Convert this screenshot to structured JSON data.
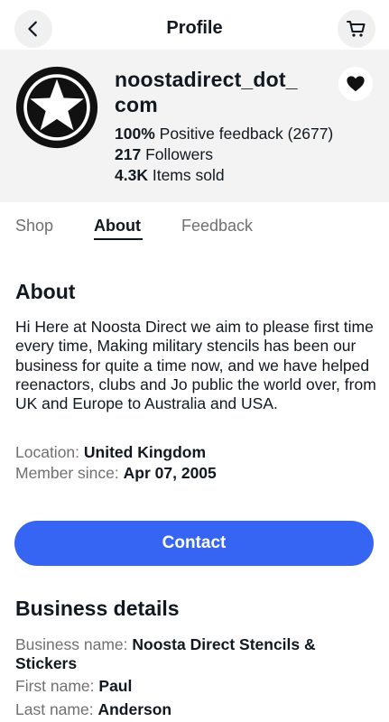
{
  "header": {
    "title": "Profile"
  },
  "icons": {
    "back": "chevron-left-icon",
    "cart": "cart-icon",
    "favorite": "heart-icon",
    "avatar": "star-logo"
  },
  "profile": {
    "name": "noostadirect_dot_ com",
    "feedback_pct": "100%",
    "feedback_text": "Positive feedback (2677)",
    "followers_count": "217",
    "followers_text": "Followers",
    "items_sold_count": "4.3K",
    "items_sold_text": "Items sold"
  },
  "tabs": [
    {
      "label": "Shop",
      "active": false
    },
    {
      "label": "About",
      "active": true
    },
    {
      "label": "Feedback",
      "active": false
    }
  ],
  "about": {
    "heading": "About",
    "bio": "Hi Here at Noosta Direct we aim to please first time every time, Making military stencils has been our business for quite a time now, and we have helped reenactors, clubs and Jo public the world over, from UK and Europe to Australia and USA.",
    "location_label": "Location:",
    "location_value": "United Kingdom",
    "member_label": "Member since:",
    "member_value": "Apr 07, 2005"
  },
  "contact_button": "Contact",
  "business": {
    "heading": "Business details",
    "name_label": "Business name:",
    "name_value": "Noosta Direct Stencils & Stickers",
    "first_label": "First name:",
    "first_value": "Paul",
    "last_label": "Last name:",
    "last_value": "Anderson"
  },
  "colors": {
    "accent": "#3665f3",
    "band": "#f3f3f3",
    "muted": "#707070",
    "text": "#111820"
  }
}
